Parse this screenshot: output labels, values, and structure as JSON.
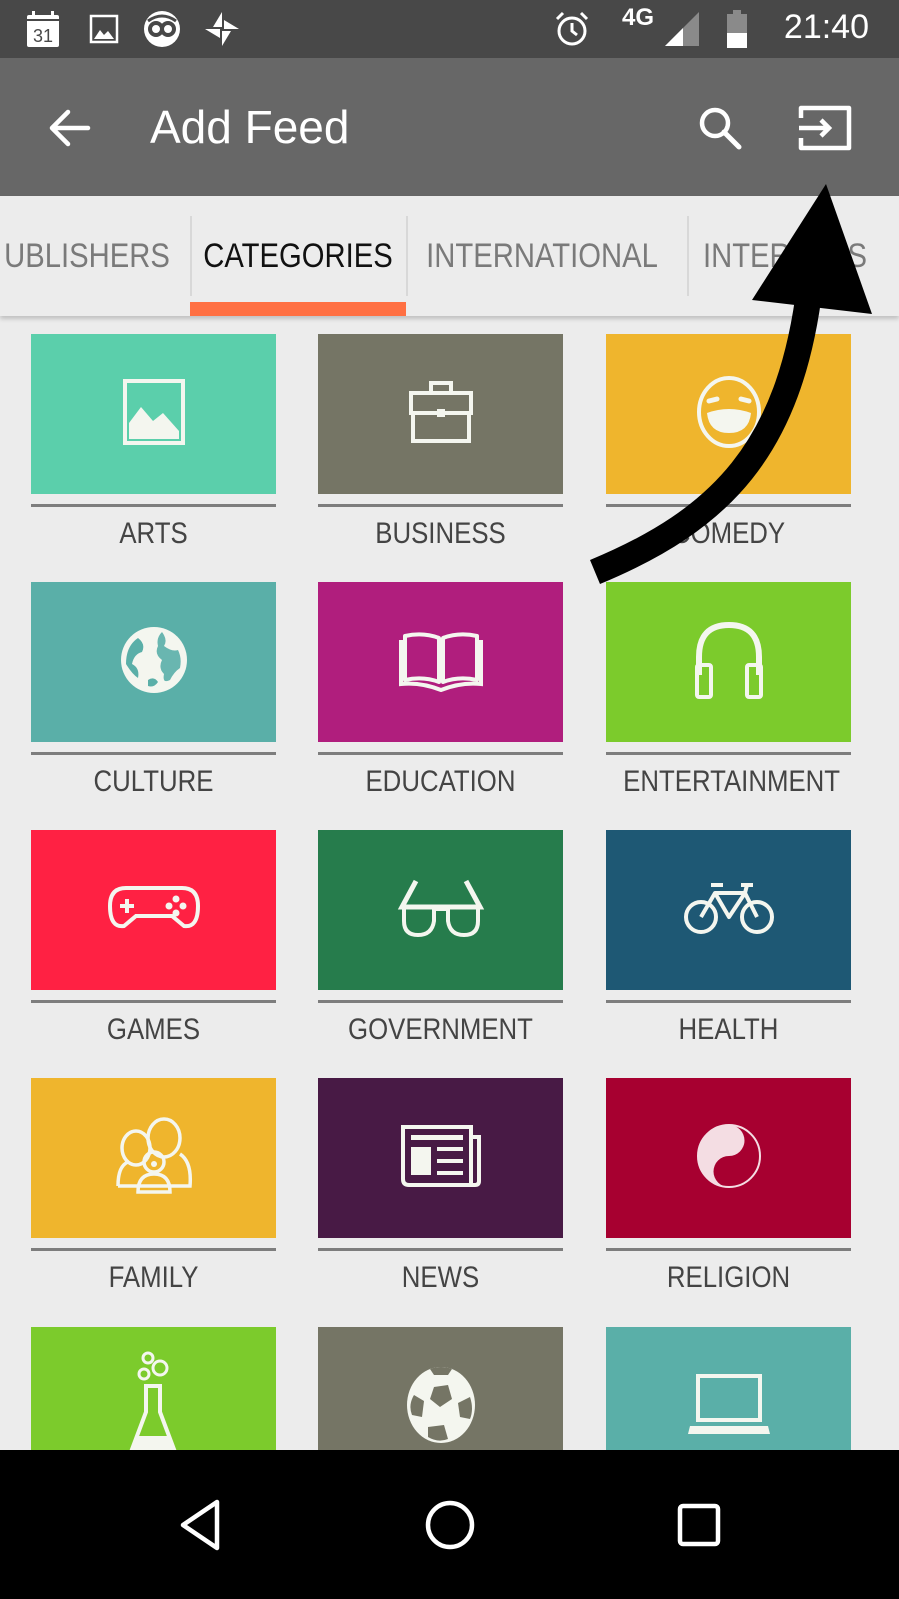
{
  "status_bar": {
    "left_icons": [
      "calendar-icon",
      "gallery-icon",
      "app-notification-icon",
      "pinwheel-icon"
    ],
    "calendar_day": "31",
    "right_icons": [
      "alarm-icon",
      "network-4g-icon",
      "signal-icon",
      "battery-icon"
    ],
    "network": "4G",
    "time": "21:40"
  },
  "app_bar": {
    "title": "Add Feed",
    "back_icon": "arrow-back-icon",
    "actions": [
      "search-icon",
      "import-icon"
    ]
  },
  "tabs": [
    {
      "label": "UBLISHERS",
      "active": false
    },
    {
      "label": "CATEGORIES",
      "active": true
    },
    {
      "label": "INTERNATIONAL",
      "active": false
    },
    {
      "label": "INTERESTS",
      "active": false
    }
  ],
  "accent_color": "#ff7043",
  "categories": [
    {
      "label": "ARTS",
      "icon": "picture-icon",
      "color": "#5bcfab"
    },
    {
      "label": "BUSINESS",
      "icon": "briefcase-icon",
      "color": "#757565"
    },
    {
      "label": "COMEDY",
      "icon": "laughing-face-icon",
      "color": "#efb52d"
    },
    {
      "label": "CULTURE",
      "icon": "globe-icon",
      "color": "#5aafa8"
    },
    {
      "label": "EDUCATION",
      "icon": "book-icon",
      "color": "#b01e7d"
    },
    {
      "label": "ENTERTAINMENT",
      "icon": "headphones-icon",
      "color": "#7ccb2c"
    },
    {
      "label": "GAMES",
      "icon": "gamepad-icon",
      "color": "#ff2143"
    },
    {
      "label": "GOVERNMENT",
      "icon": "glasses-icon",
      "color": "#267c4c"
    },
    {
      "label": "HEALTH",
      "icon": "bicycle-icon",
      "color": "#1e5874"
    },
    {
      "label": "FAMILY",
      "icon": "family-icon",
      "color": "#efb52d"
    },
    {
      "label": "NEWS",
      "icon": "newspaper-icon",
      "color": "#481a45"
    },
    {
      "label": "RELIGION",
      "icon": "yin-yang-icon",
      "color": "#a70030"
    },
    {
      "label": "",
      "icon": "flask-icon",
      "color": "#7ccb2c"
    },
    {
      "label": "",
      "icon": "soccer-ball-icon",
      "color": "#757565"
    },
    {
      "label": "",
      "icon": "laptop-icon",
      "color": "#5aafa8"
    }
  ],
  "nav_bar": [
    "back-triangle-icon",
    "home-circle-icon",
    "recents-square-icon"
  ],
  "annotation": {
    "type": "curved-arrow",
    "points_to": "import-icon",
    "color": "#000000"
  }
}
